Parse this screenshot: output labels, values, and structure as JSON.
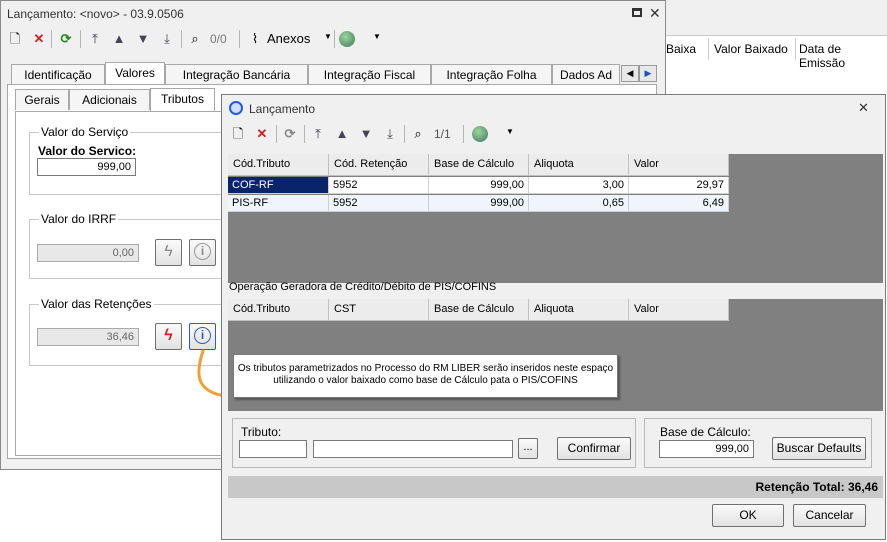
{
  "bg_window": {
    "columns": [
      "Baixa",
      "Valor Baixado",
      "Data de Emissão"
    ]
  },
  "main_window": {
    "title": "Lançamento: <novo> - 03.9.0506",
    "toolbar": {
      "counter": "0/0",
      "anexos_label": "Anexos"
    },
    "tabs": [
      "Identificação",
      "Valores",
      "Integração Bancária",
      "Integração Fiscal",
      "Integração Folha",
      "Dados Ad"
    ],
    "subtabs": [
      "Gerais",
      "Adicionais",
      "Tributos"
    ],
    "valor_servico": {
      "group_title": "Valor do Serviço",
      "label": "Valor do Servico:",
      "value": "999,00"
    },
    "valor_irrf": {
      "group_title": "Valor do IRRF",
      "value": "0,00"
    },
    "valor_retencoes": {
      "group_title": "Valor das Retenções",
      "value": "36,46"
    }
  },
  "dialog": {
    "title": "Lançamento",
    "toolbar": {
      "counter": "1/1"
    },
    "grid1": {
      "headers": [
        "Cód.Tributo",
        "Cód. Retenção",
        "Base de Cálculo",
        "Aliquota",
        "Valor"
      ],
      "rows": [
        [
          "COF-RF",
          "5952",
          "999,00",
          "3,00",
          "29,97"
        ],
        [
          "PIS-RF",
          "5952",
          "999,00",
          "0,65",
          "6,49"
        ]
      ]
    },
    "section_label": "Operação Geradora de Crédito/Débito de PIS/COFINS",
    "grid2": {
      "headers": [
        "Cód.Tributo",
        "CST",
        "Base de Cálculo",
        "Aliquota",
        "Valor"
      ]
    },
    "tooltip": {
      "line1": "Os tributos parametrizados no Processo do RM LIBER serão inseridos neste espaço",
      "line2": "utilizando o valor baixado como base de Cálculo pata o PIS/COFINS"
    },
    "tributo_label": "Tributo:",
    "tributo_code": "",
    "tributo_desc": "",
    "browse_label": "...",
    "confirmar_label": "Confirmar",
    "base_calculo_label": "Base de Cálculo:",
    "base_calculo_value": "999,00",
    "buscar_defaults_label": "Buscar Defaults",
    "retencao_total": "Retenção Total: 36,46",
    "ok_label": "OK",
    "cancelar_label": "Cancelar"
  },
  "colors": {
    "selected_row": "#0a246a",
    "grid_bg": "#808080",
    "arrow": "#f0a030",
    "stop_red": "#d42020"
  }
}
